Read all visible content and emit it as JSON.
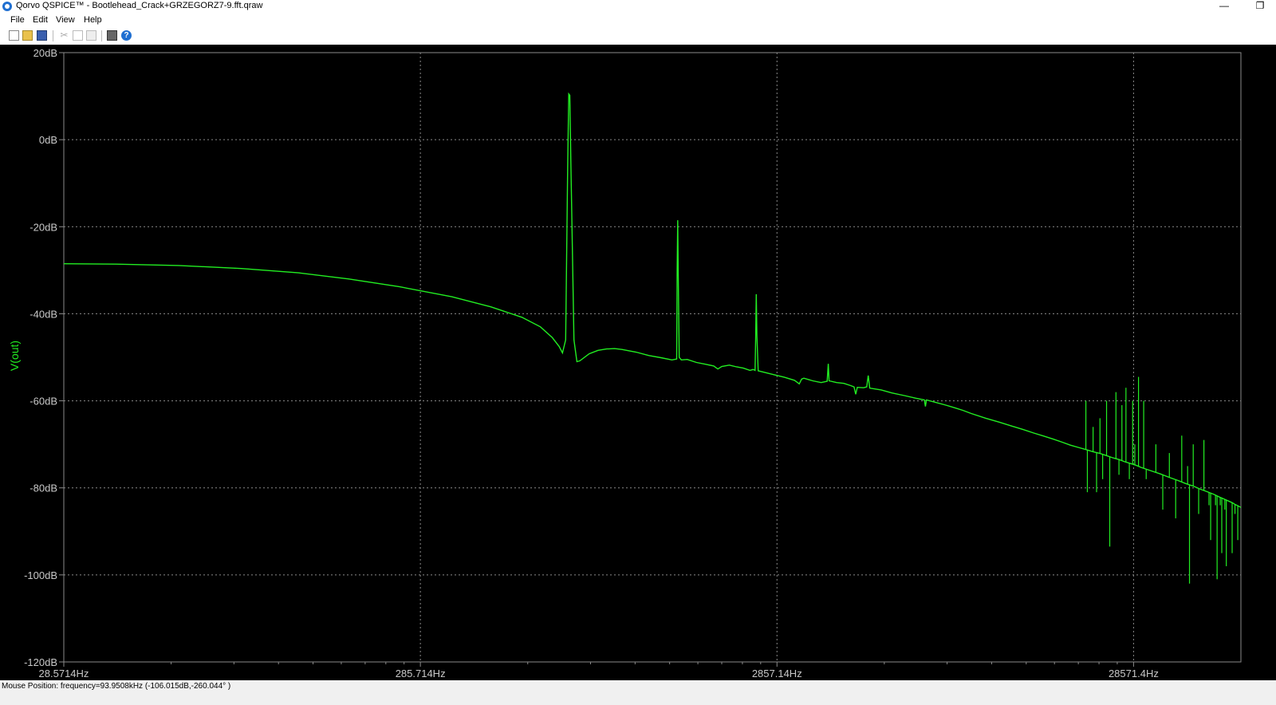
{
  "window": {
    "title": "Qorvo QSPICE™ - Bootlehead_Crack+GRZEGORZ7-9.fft.qraw",
    "minimize_glyph": "—",
    "restore_glyph": "❐"
  },
  "menu": [
    "File",
    "Edit",
    "View",
    "Help"
  ],
  "toolbar": {
    "icons": [
      "new-icon",
      "open-icon",
      "save-icon",
      "cut-icon",
      "copy-icon",
      "paste-icon",
      "print-icon",
      "help-icon"
    ],
    "help_glyph": "?",
    "cut_glyph": "✂"
  },
  "colors": {
    "background": "#000000",
    "trace": "#22ee22",
    "grid": "#8a8a8a",
    "text": "#c8c8c8"
  },
  "chart_data": {
    "type": "line",
    "xscale": "log",
    "xlim": [
      28.5714,
      57142.8
    ],
    "ylim": [
      -120,
      20
    ],
    "yticks": [
      20,
      0,
      -20,
      -40,
      -60,
      -80,
      -100,
      -120
    ],
    "ytick_labels": [
      "20dB",
      "0dB",
      "-20dB",
      "-40dB",
      "-60dB",
      "-80dB",
      "-100dB",
      "-120dB"
    ],
    "xticks": [
      28.5714,
      285.714,
      2857.14,
      28571.4
    ],
    "xtick_labels": [
      "28.5714Hz",
      "285.714Hz",
      "2857.14Hz",
      "28571.4Hz"
    ],
    "ylabel": "V(out)",
    "grid": true,
    "series": [
      {
        "name": "V(out)",
        "points": [
          [
            28.57,
            -28.5
          ],
          [
            40,
            -28.6
          ],
          [
            60,
            -28.9
          ],
          [
            90,
            -29.6
          ],
          [
            130,
            -30.6
          ],
          [
            180,
            -32.0
          ],
          [
            250,
            -33.8
          ],
          [
            350,
            -36.1
          ],
          [
            450,
            -38.4
          ],
          [
            550,
            -40.8
          ],
          [
            620,
            -43.0
          ],
          [
            670,
            -45.5
          ],
          [
            700,
            -47.5
          ],
          [
            715,
            -49.0
          ],
          [
            730,
            -46
          ],
          [
            740,
            -5
          ],
          [
            745,
            10.5
          ],
          [
            750,
            10.2
          ],
          [
            755,
            -5
          ],
          [
            770,
            -46
          ],
          [
            785,
            -51
          ],
          [
            800,
            -50.8
          ],
          [
            850,
            -49.2
          ],
          [
            900,
            -48.4
          ],
          [
            950,
            -48.1
          ],
          [
            1000,
            -48.0
          ],
          [
            1050,
            -48.2
          ],
          [
            1150,
            -48.8
          ],
          [
            1250,
            -49.6
          ],
          [
            1350,
            -50.1
          ],
          [
            1450,
            -50.6
          ],
          [
            1495,
            -50.4
          ],
          [
            1500,
            -30
          ],
          [
            1505,
            -18.5
          ],
          [
            1510,
            -30
          ],
          [
            1520,
            -50
          ],
          [
            1540,
            -50.6
          ],
          [
            1600,
            -50.5
          ],
          [
            1700,
            -51.2
          ],
          [
            1800,
            -51.6
          ],
          [
            1900,
            -52.0
          ],
          [
            1950,
            -52.7
          ],
          [
            2000,
            -52.1
          ],
          [
            2100,
            -51.8
          ],
          [
            2200,
            -52.2
          ],
          [
            2300,
            -52.5
          ],
          [
            2400,
            -53.0
          ],
          [
            2450,
            -52.8
          ],
          [
            2480,
            -53.0
          ],
          [
            2490,
            -45
          ],
          [
            2500,
            -35.5
          ],
          [
            2510,
            -45
          ],
          [
            2530,
            -53.1
          ],
          [
            2800,
            -54.0
          ],
          [
            3000,
            -54.6
          ],
          [
            3200,
            -55.3
          ],
          [
            3300,
            -56.1
          ],
          [
            3350,
            -55.0
          ],
          [
            3400,
            -54.8
          ],
          [
            3600,
            -55.4
          ],
          [
            3800,
            -55.8
          ],
          [
            3950,
            -55.5
          ],
          [
            3980,
            -51.5
          ],
          [
            4000,
            -55.4
          ],
          [
            4200,
            -55.8
          ],
          [
            4400,
            -56.0
          ],
          [
            4600,
            -56.5
          ],
          [
            4700,
            -56.8
          ],
          [
            4750,
            -58.5
          ],
          [
            4800,
            -56.9
          ],
          [
            5000,
            -57.0
          ],
          [
            5100,
            -56.8
          ],
          [
            5150,
            -54.2
          ],
          [
            5200,
            -57.1
          ],
          [
            5600,
            -57.5
          ],
          [
            6000,
            -58.2
          ],
          [
            6500,
            -58.8
          ],
          [
            7000,
            -59.4
          ],
          [
            7400,
            -59.8
          ],
          [
            7450,
            -61.3
          ],
          [
            7500,
            -59.8
          ],
          [
            8000,
            -60.4
          ],
          [
            8500,
            -61.0
          ],
          [
            9000,
            -61.6
          ],
          [
            9500,
            -62.2
          ],
          [
            10000,
            -62.9
          ],
          [
            11000,
            -64.0
          ],
          [
            12000,
            -64.9
          ],
          [
            13000,
            -65.8
          ],
          [
            14000,
            -66.6
          ],
          [
            15000,
            -67.4
          ],
          [
            16000,
            -68.1
          ],
          [
            17000,
            -68.8
          ],
          [
            18000,
            -69.5
          ],
          [
            19000,
            -70.2
          ],
          [
            20000,
            -70.7
          ],
          [
            21000,
            -71.2
          ],
          [
            22000,
            -71.7
          ],
          [
            23000,
            -72.1
          ],
          [
            24000,
            -72.6
          ],
          [
            25000,
            -73.1
          ],
          [
            26000,
            -73.5
          ],
          [
            27000,
            -74.0
          ],
          [
            28000,
            -74.4
          ],
          [
            29000,
            -74.8
          ],
          [
            30000,
            -75.3
          ],
          [
            32000,
            -76.1
          ],
          [
            34000,
            -76.8
          ],
          [
            36000,
            -77.6
          ],
          [
            38000,
            -78.3
          ],
          [
            40000,
            -79.0
          ],
          [
            42000,
            -79.6
          ],
          [
            44000,
            -80.3
          ],
          [
            46000,
            -80.9
          ],
          [
            48000,
            -81.5
          ],
          [
            50000,
            -82.2
          ],
          [
            52000,
            -82.8
          ],
          [
            54000,
            -83.4
          ],
          [
            55000,
            -83.8
          ],
          [
            56000,
            -84.1
          ],
          [
            57142.8,
            -84.5
          ]
        ],
        "spikes": [
          [
            21000,
            -60
          ],
          [
            21200,
            -81
          ],
          [
            22000,
            -66
          ],
          [
            22500,
            -81
          ],
          [
            23000,
            -64
          ],
          [
            23400,
            -78
          ],
          [
            24000,
            -60
          ],
          [
            24500,
            -93.5
          ],
          [
            25500,
            -58
          ],
          [
            26000,
            -77
          ],
          [
            26500,
            -61
          ],
          [
            27200,
            -57
          ],
          [
            27800,
            -78
          ],
          [
            28400,
            -60
          ],
          [
            28800,
            -70
          ],
          [
            29500,
            -54.5
          ],
          [
            30500,
            -60
          ],
          [
            31000,
            -78
          ],
          [
            33000,
            -70
          ],
          [
            34500,
            -85
          ],
          [
            36000,
            -72
          ],
          [
            37500,
            -87
          ],
          [
            39000,
            -68
          ],
          [
            40500,
            -75
          ],
          [
            41000,
            -102
          ],
          [
            42000,
            -70
          ],
          [
            43500,
            -86
          ],
          [
            45000,
            -69
          ],
          [
            46500,
            -84
          ],
          [
            47000,
            -92
          ],
          [
            48500,
            -84
          ],
          [
            49000,
            -101
          ],
          [
            50000,
            -84
          ],
          [
            50500,
            -95
          ],
          [
            51500,
            -85
          ],
          [
            52000,
            -98
          ],
          [
            53000,
            -83
          ],
          [
            54000,
            -95
          ],
          [
            55000,
            -86
          ],
          [
            56000,
            -92
          ]
        ]
      }
    ]
  },
  "status": {
    "mouse_position": "Mouse Position: frequency=93.9508kHz   (-106.015dB,-260.044° )"
  }
}
